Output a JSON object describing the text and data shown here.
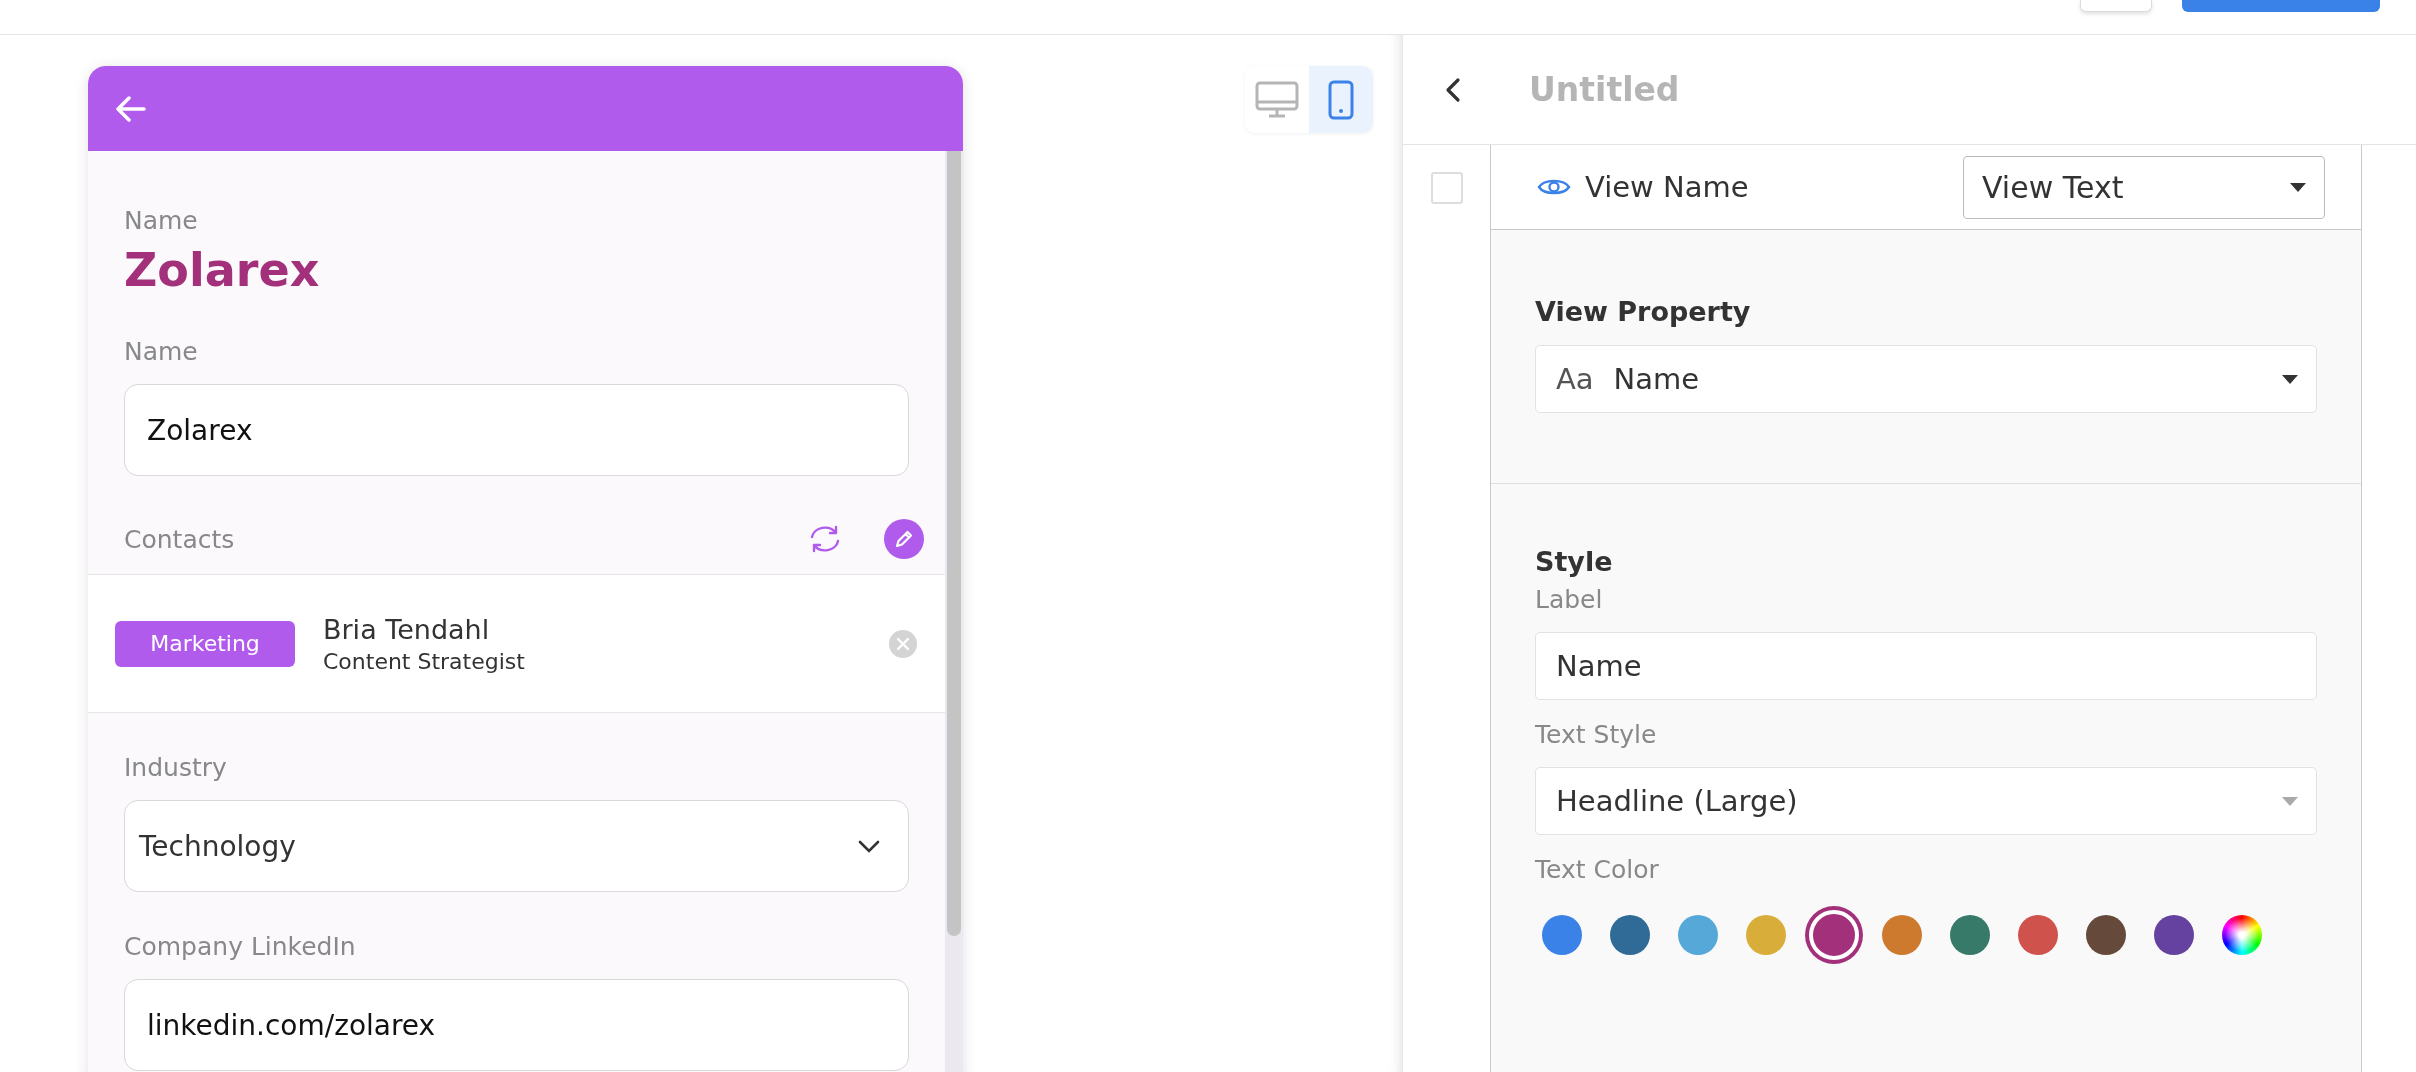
{
  "preview": {
    "device_toggle": [
      {
        "kind": "desktop",
        "selected": false
      },
      {
        "kind": "mobile",
        "selected": true
      }
    ],
    "fields": [
      {
        "kind": "heading",
        "label": "Name",
        "value": "Zolarex"
      },
      {
        "kind": "input",
        "label": "Name",
        "value": "Zolarex"
      },
      {
        "kind": "contacts",
        "label": "Contacts",
        "contacts": [
          {
            "tag": "Marketing",
            "name": "Bria Tendahl",
            "role": "Content Strategist"
          }
        ]
      },
      {
        "kind": "select",
        "label": "Industry",
        "value": "Technology"
      },
      {
        "kind": "input",
        "label": "Company LinkedIn",
        "value": "linkedin.com/zolarex"
      }
    ]
  },
  "editor": {
    "title": "Untitled",
    "item": {
      "checked": false,
      "view_label": "View Name",
      "mode": "View Text",
      "property_heading": "View Property",
      "property_icon": "Aa",
      "property": "Name",
      "style_heading": "Style",
      "label_caption": "Label",
      "label_value": "Name",
      "text_style_caption": "Text Style",
      "text_style": "Headline (Large)",
      "text_color_caption": "Text Color",
      "swatches": [
        {
          "kind": "solid",
          "color": "#3b82e8",
          "selected": false
        },
        {
          "kind": "solid",
          "color": "#2f6b96",
          "selected": false
        },
        {
          "kind": "solid",
          "color": "#55a8d8",
          "selected": false
        },
        {
          "kind": "solid",
          "color": "#d8ad3a",
          "selected": false
        },
        {
          "kind": "solid",
          "color": "#a3307a",
          "selected": true
        },
        {
          "kind": "solid",
          "color": "#cd7a2e",
          "selected": false
        },
        {
          "kind": "solid",
          "color": "#377a6a",
          "selected": false
        },
        {
          "kind": "solid",
          "color": "#d0524c",
          "selected": false
        },
        {
          "kind": "solid",
          "color": "#654a3c",
          "selected": false
        },
        {
          "kind": "solid",
          "color": "#6542a0",
          "selected": false
        },
        {
          "kind": "picker",
          "selected": false
        }
      ]
    }
  }
}
